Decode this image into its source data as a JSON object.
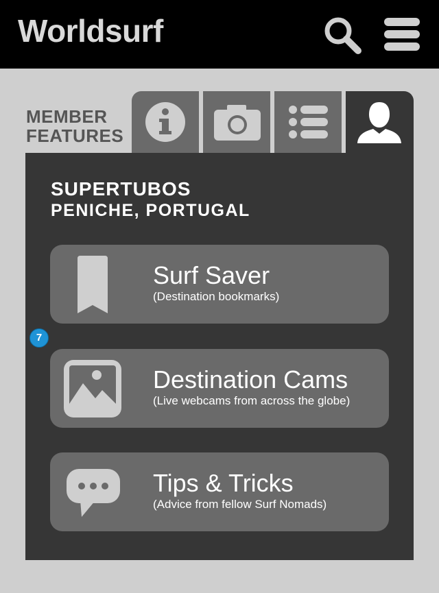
{
  "header": {
    "app_title": "Worldsurf",
    "search_icon": "search-icon",
    "menu_icon": "hamburger-menu-icon"
  },
  "tabs": {
    "section_label_line1": "MEMBER",
    "section_label_line2": "FEATURES",
    "items": [
      {
        "icon": "info-icon",
        "active": false
      },
      {
        "icon": "camera-icon",
        "active": false
      },
      {
        "icon": "list-icon",
        "active": false
      },
      {
        "icon": "user-icon",
        "active": true
      }
    ]
  },
  "location": {
    "name": "SUPERTUBOS",
    "place": "PENICHE, PORTUGAL"
  },
  "features": [
    {
      "icon": "bookmark-icon",
      "title": "Surf Saver",
      "subtitle": "(Destination bookmarks)"
    },
    {
      "icon": "image-icon",
      "title": "Destination Cams",
      "subtitle": "(Live webcams from across the globe)"
    },
    {
      "icon": "chat-bubble-icon",
      "title": "Tips & Tricks",
      "subtitle": "(Advice from fellow Surf Nomads)"
    }
  ],
  "badge": {
    "count": "7"
  },
  "colors": {
    "topbar": "#000000",
    "background": "#cfcfcf",
    "panel": "#363636",
    "card": "#6a6a6a",
    "badge": "#1f93d6"
  }
}
